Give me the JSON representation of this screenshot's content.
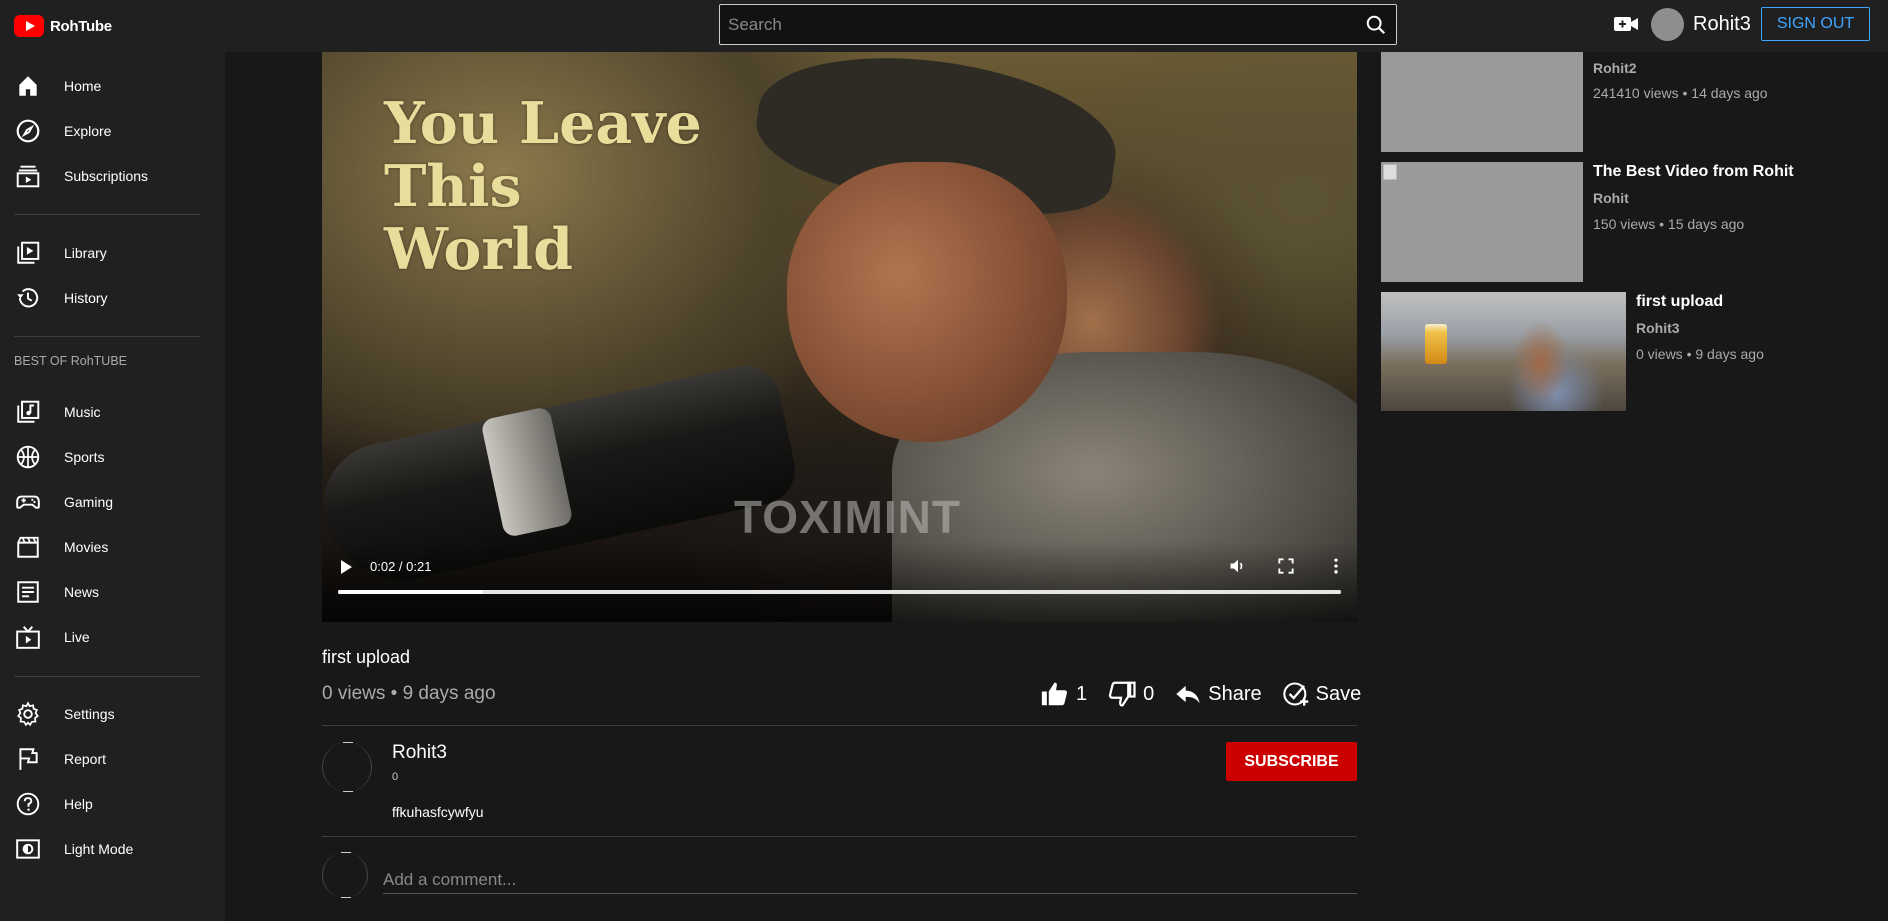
{
  "app": {
    "name": "RohTube"
  },
  "search": {
    "placeholder": "Search"
  },
  "header": {
    "username": "Rohit3",
    "signout_label": "SIGN OUT"
  },
  "sidebar": {
    "primary": [
      {
        "label": "Home",
        "icon": "home-icon"
      },
      {
        "label": "Explore",
        "icon": "compass-icon"
      },
      {
        "label": "Subscriptions",
        "icon": "subscriptions-icon"
      }
    ],
    "library": [
      {
        "label": "Library",
        "icon": "library-icon"
      },
      {
        "label": "History",
        "icon": "history-icon"
      }
    ],
    "best_of_title": "BEST OF RohTUBE",
    "best_of": [
      {
        "label": "Music",
        "icon": "music-icon"
      },
      {
        "label": "Sports",
        "icon": "sports-icon"
      },
      {
        "label": "Gaming",
        "icon": "gaming-icon"
      },
      {
        "label": "Movies",
        "icon": "movies-icon"
      },
      {
        "label": "News",
        "icon": "news-icon"
      },
      {
        "label": "Live",
        "icon": "live-icon"
      }
    ],
    "footer": [
      {
        "label": "Settings",
        "icon": "gear-icon"
      },
      {
        "label": "Report",
        "icon": "flag-icon"
      },
      {
        "label": "Help",
        "icon": "help-icon"
      },
      {
        "label": "Light Mode",
        "icon": "light-mode-icon"
      }
    ]
  },
  "player": {
    "overlay_text_line1": "You Leave",
    "overlay_text_line2": "This",
    "overlay_text_line3": "World",
    "watermark": "TOXIMINT",
    "time": "0:02 / 0:21",
    "progress": 0.145
  },
  "video": {
    "title": "first upload",
    "meta": "0 views • 9 days ago",
    "likes": "1",
    "dislikes": "0",
    "share_label": "Share",
    "save_label": "Save"
  },
  "channel": {
    "name": "Rohit3",
    "subscribers": "0",
    "subscribe_label": "SUBSCRIBE",
    "description": "ffkuhasfcywfyu"
  },
  "comments": {
    "placeholder": "Add a comment..."
  },
  "recommendations": [
    {
      "title": "",
      "channel": "Rohit2",
      "meta": "241410 views • 14 days ago"
    },
    {
      "title": "The Best Video from Rohit",
      "channel": "Rohit",
      "meta": "150 views • 15 days ago"
    },
    {
      "title": "first upload",
      "channel": "Rohit3",
      "meta": "0 views • 9 days ago"
    }
  ],
  "colors": {
    "accent_red": "#cc0000",
    "signout_blue": "#3ea6ff",
    "background": "#181818",
    "sidebar": "#202020"
  }
}
